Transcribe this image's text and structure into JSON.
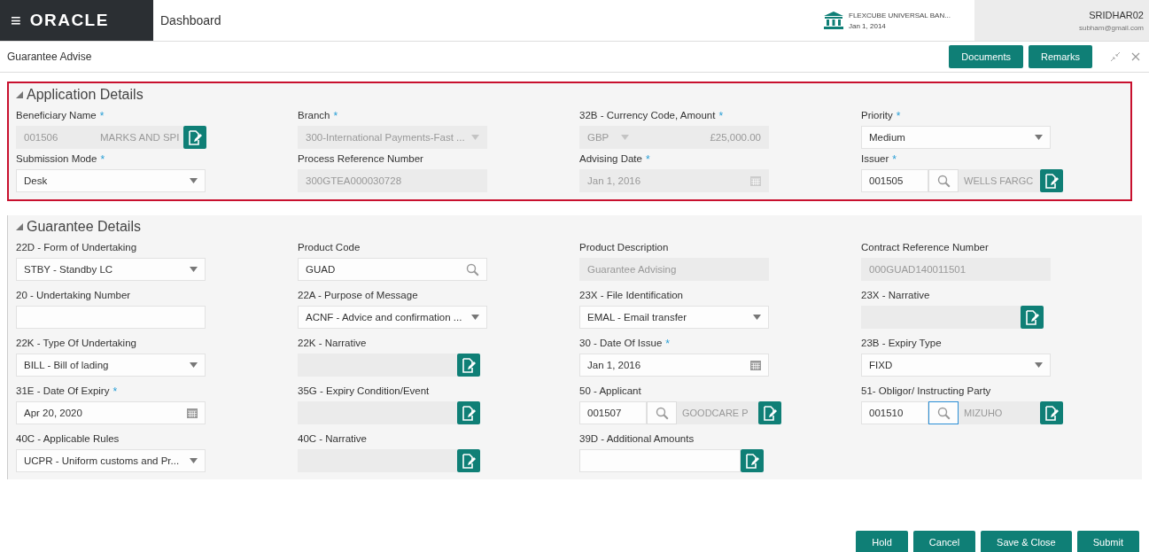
{
  "header": {
    "menu": "≡",
    "logo": "ORACLE",
    "page": "Dashboard",
    "entity": "FLEXCUBE UNIVERSAL BAN...",
    "entity_date": "Jan 1, 2014",
    "user": "SRIDHAR02",
    "email": "subham@gmail.com"
  },
  "screen": {
    "title": "Guarantee Advise",
    "buttons": [
      "Documents",
      "Remarks"
    ]
  },
  "sections": [
    {
      "title": "Application Details",
      "highlighted": true,
      "expanded": true,
      "fields": [
        {
          "label": "Beneficiary Name",
          "required_mark": "*",
          "kind": "beneficiary",
          "code": "001506",
          "name": "MARKS AND SPI"
        },
        {
          "label": "Branch",
          "required_mark": "*",
          "kind": "select",
          "value": "300-International Payments-Fast ...",
          "disabled": true
        },
        {
          "label": "32B - Currency Code, Amount",
          "required_mark": "*",
          "kind": "currency",
          "currency": "GBP",
          "amount": "£25,000.00"
        },
        {
          "label": "Priority",
          "required_mark": "*",
          "kind": "select",
          "value": "Medium",
          "disabled": false
        },
        {
          "label": "Submission Mode",
          "required_mark": "*",
          "kind": "select",
          "value": "Desk",
          "disabled": false
        },
        {
          "label": "Process Reference Number",
          "kind": "text",
          "value": "300GTEA000030728",
          "disabled": true
        },
        {
          "label": "Advising Date",
          "required_mark": "*",
          "kind": "date",
          "value": "Jan 1, 2016",
          "disabled": true
        },
        {
          "label": "Issuer",
          "required_mark": "*",
          "kind": "party",
          "code": "001505",
          "name": "WELLS FARGC",
          "focused": false
        }
      ]
    },
    {
      "title": "Guarantee Details",
      "highlighted": false,
      "expanded": true,
      "fields": [
        {
          "label": "22D - Form of Undertaking",
          "kind": "select",
          "value": "STBY - Standby LC",
          "disabled": false
        },
        {
          "label": "Product Code",
          "kind": "search",
          "value": "GUAD"
        },
        {
          "label": "Product Description",
          "kind": "text",
          "value": "Guarantee Advising",
          "disabled": true
        },
        {
          "label": "Contract Reference Number",
          "kind": "text",
          "value": "000GUAD140011501",
          "disabled": true
        },
        {
          "label": "20 - Undertaking Number",
          "kind": "text",
          "disabled": false
        },
        {
          "label": "22A - Purpose of Message",
          "kind": "select",
          "value": "ACNF - Advice and confirmation ...",
          "disabled": false
        },
        {
          "label": "23X - File Identification",
          "kind": "select",
          "value": "EMAL - Email transfer",
          "disabled": false
        },
        {
          "label": "23X - Narrative",
          "kind": "narrative",
          "disabled": true
        },
        {
          "label": "22K - Type Of Undertaking",
          "kind": "select",
          "value": "BILL - Bill of lading",
          "disabled": false
        },
        {
          "label": "22K - Narrative",
          "kind": "narrative",
          "disabled": true
        },
        {
          "label": "30 - Date Of Issue",
          "required_mark": "*",
          "kind": "date",
          "value": "Jan 1, 2016",
          "disabled": false
        },
        {
          "label": "23B - Expiry Type",
          "kind": "select",
          "value": "FIXD",
          "disabled": false
        },
        {
          "label": "31E - Date Of Expiry",
          "required_mark": "*",
          "kind": "date",
          "value": "Apr 20, 2020",
          "disabled": false
        },
        {
          "label": "35G - Expiry Condition/Event",
          "kind": "narrative",
          "disabled": true
        },
        {
          "label": "50 - Applicant",
          "kind": "party",
          "code": "001507",
          "name": "GOODCARE P",
          "focused": false
        },
        {
          "label": "51- Obligor/ Instructing Party",
          "kind": "party",
          "code": "001510",
          "name": "MIZUHO",
          "focused": true
        },
        {
          "label": "40C - Applicable Rules",
          "kind": "select",
          "value": "UCPR - Uniform customs and Pr...",
          "disabled": false
        },
        {
          "label": "40C - Narrative",
          "kind": "narrative",
          "disabled": true
        },
        {
          "label": "39D - Additional Amounts",
          "kind": "narrative",
          "disabled": false
        }
      ]
    }
  ],
  "footer_buttons": [
    "Hold",
    "Cancel",
    "Save & Close",
    "Submit"
  ]
}
